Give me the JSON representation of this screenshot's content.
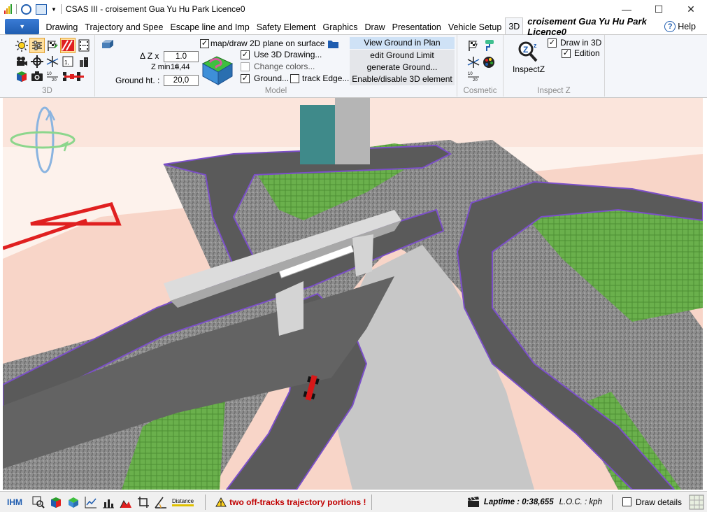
{
  "window": {
    "title": "CSAS III - croisement Gua Yu Hu Park Licence0",
    "controls": [
      "minimize",
      "maximize",
      "close"
    ]
  },
  "tabs": [
    {
      "label": "Drawing"
    },
    {
      "label": "Trajectory and Spee"
    },
    {
      "label": "Escape line and Imp"
    },
    {
      "label": "Safety Element"
    },
    {
      "label": "Graphics"
    },
    {
      "label": "Draw"
    },
    {
      "label": "Presentation"
    },
    {
      "label": "Vehicle Setup"
    },
    {
      "label": "3D"
    }
  ],
  "active_tab": "3D",
  "document_title": "croisement Gua Yu Hu Park Licence0",
  "help_label": "Help",
  "ribbon": {
    "groups": {
      "g3d": "3D",
      "model": "Model",
      "cosmetic": "Cosmetic",
      "inspect": "Inspect Z"
    },
    "model": {
      "dz_label": "Δ Z x",
      "dz_value": "1.0",
      "zmin_label": "Z min. =",
      "zmin_value": "16,44",
      "ground_label": "Ground ht. :",
      "ground_value": "20,0",
      "map_draw_label": "map/draw 2D plane on surface",
      "use3d_label": "Use 3D Drawing...",
      "change_colors_label": "Change colors...",
      "ground_cb_label": "Ground...",
      "track_edge_label": "track Edge...",
      "buttons": [
        "View Ground in Plan",
        "edit Ground Limit",
        "generate Ground...",
        "Enable/disable 3D element"
      ]
    },
    "inspect": {
      "inspectz_label": "InspectZ",
      "draw3d_label": "Draw in 3D",
      "edition_label": "Edition"
    }
  },
  "status": {
    "ihm_label": "IHM",
    "distance_label": "Distance",
    "warning": "two off-tracks trajectory portions !",
    "laptime": "Laptime : 0:38,655",
    "loc": "L.O.C. : kph",
    "draw_details": "Draw details"
  },
  "colors": {
    "accent": "#1f5db0",
    "warning": "#c00000"
  }
}
